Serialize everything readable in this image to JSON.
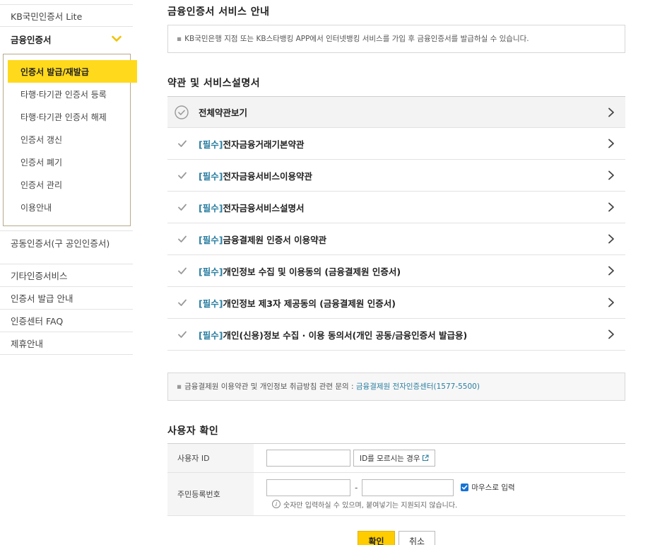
{
  "sidebar": {
    "items_top": [
      {
        "label": "KB국민인증서 Lite"
      }
    ],
    "open_item": {
      "label": "금융인증서"
    },
    "submenu": [
      {
        "label": "인증서 발급/재발급",
        "active": true
      },
      {
        "label": "타행·타기관 인증서 등록"
      },
      {
        "label": "타행·타기관 인증서 해제"
      },
      {
        "label": "인증서 갱신"
      },
      {
        "label": "인증서 폐기"
      },
      {
        "label": "인증서 관리"
      },
      {
        "label": "이용안내"
      }
    ],
    "items_bottom": [
      {
        "label": "공동인증서(구 공인인증서)"
      },
      {
        "label": "기타인증서비스"
      },
      {
        "label": "인증서 발급 안내"
      },
      {
        "label": "인증센터 FAQ"
      },
      {
        "label": "제휴안내"
      }
    ]
  },
  "service": {
    "title": "금융인증서 서비스 안내",
    "notice": "KB국민은행 지점 또는 KB스타뱅킹 APP에서 인터넷뱅킹 서비스를 가입 후 금융인증서를 발급하실 수 있습니다."
  },
  "terms": {
    "title": "약관 및 서비스설명서",
    "view_all": "전체약관보기",
    "required_tag": "[필수]",
    "items": [
      {
        "label": "전자금융거래기본약관"
      },
      {
        "label": "전자금융서비스이용약관"
      },
      {
        "label": "전자금융서비스설명서"
      },
      {
        "label": "금융결제원 인증서 이용약관"
      },
      {
        "label": "개인정보 수집 및 이용동의 (금융결제원 인증서)"
      },
      {
        "label": "개인정보 제3자 제공동의 (금융결제원 인증서)"
      },
      {
        "label": "개인(신용)정보 수집 · 이용 동의서(개인 공동/금융인증서 발급용)"
      }
    ],
    "inquiry_prefix": "금융결제원 이용약관 및 개인정보 취급방침 관련 문의 : ",
    "inquiry_link": "금융결제원 전자인증센터",
    "inquiry_phone": "(1577-5500)"
  },
  "user_check": {
    "title": "사용자 확인",
    "id_label": "사용자 ID",
    "id_value": "",
    "forgot_id_button": "ID를 모르시는 경우",
    "rrn_label": "주민등록번호",
    "rrn_front": "",
    "rrn_back": "",
    "dash": "-",
    "mouse_input_label": "마우스로 입력",
    "mouse_input_checked": true,
    "hint": "숫자만 입력하실 수 있으며, 붙여넣기는 지원되지 않습니다."
  },
  "buttons": {
    "ok": "확인",
    "cancel": "취소"
  },
  "colors": {
    "accent": "#ffcc00",
    "active_menu": "#ffd91c",
    "link": "#2a7ea1",
    "checkbox": "#1572d6"
  }
}
